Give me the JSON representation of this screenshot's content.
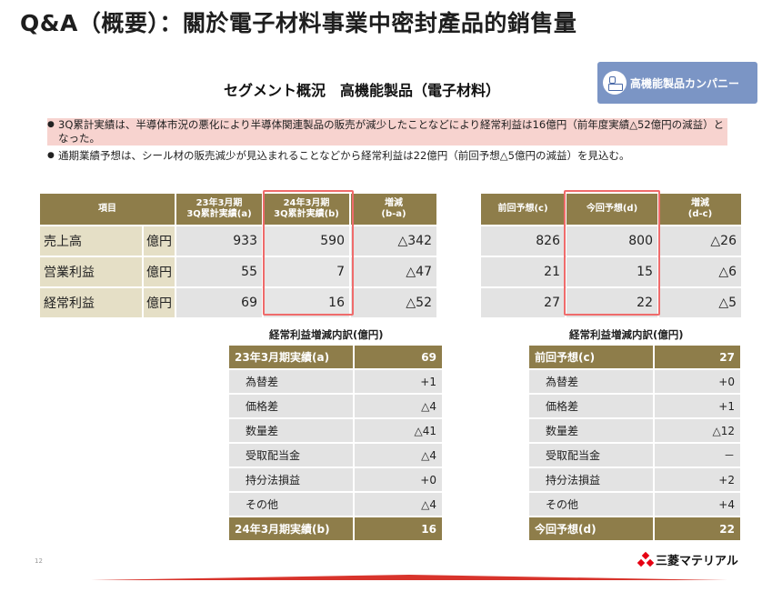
{
  "page": {
    "title": "Q&A（概要）：關於電子材料事業中密封產品的銷售量",
    "slide_heading": "セグメント概況　高機能製品（電子材料）",
    "badge_label": "高機能製品カンパニー",
    "page_number": "12",
    "company_logo_text": "三菱マテリアル"
  },
  "bullets": [
    "3Q累計実績は、半導体市況の悪化により半導体関連製品の販売が減少したことなどにより経常利益は16億円（前年度実績△52億円の減益）となった。",
    "通期業績予想は、シール材の販売減少が見込まれることなどから経常利益は22億円（前回予想△5億円の減益）を見込む。"
  ],
  "summary_left": {
    "headers": [
      "項目",
      "23年3月期\n3Q累計実績(a)",
      "24年3月期\n3Q累計実績(b)",
      "増減\n(b-a)"
    ],
    "rows": [
      {
        "item": "売上高",
        "unit": "億円",
        "a": "933",
        "b": "590",
        "diff": "△342"
      },
      {
        "item": "営業利益",
        "unit": "億円",
        "a": "55",
        "b": "7",
        "diff": "△47"
      },
      {
        "item": "経常利益",
        "unit": "億円",
        "a": "69",
        "b": "16",
        "diff": "△52"
      }
    ]
  },
  "summary_right": {
    "headers": [
      "前回予想(c)",
      "今回予想(d)",
      "増減\n(d-c)"
    ],
    "rows": [
      {
        "c": "826",
        "d": "800",
        "diff": "△26"
      },
      {
        "c": "21",
        "d": "15",
        "diff": "△6"
      },
      {
        "c": "27",
        "d": "22",
        "diff": "△5"
      }
    ]
  },
  "breakdown_left": {
    "caption": "経常利益増減内訳(億円)",
    "start_label": "23年3月期実績(a)",
    "start_value": "69",
    "items": [
      {
        "label": "為替差",
        "value": "+1"
      },
      {
        "label": "価格差",
        "value": "△4"
      },
      {
        "label": "数量差",
        "value": "△41"
      },
      {
        "label": "受取配当金",
        "value": "△4"
      },
      {
        "label": "持分法損益",
        "value": "+0"
      },
      {
        "label": "その他",
        "value": "△4"
      }
    ],
    "end_label": "24年3月期実績(b)",
    "end_value": "16"
  },
  "breakdown_right": {
    "caption": "経常利益増減内訳(億円)",
    "start_label": "前回予想(c)",
    "start_value": "27",
    "items": [
      {
        "label": "為替差",
        "value": "+0"
      },
      {
        "label": "価格差",
        "value": "+1"
      },
      {
        "label": "数量差",
        "value": "△12"
      },
      {
        "label": "受取配当金",
        "value": "－"
      },
      {
        "label": "持分法損益",
        "value": "+2"
      },
      {
        "label": "その他",
        "value": "+4"
      }
    ],
    "end_label": "今回予想(d)",
    "end_value": "22"
  },
  "colors": {
    "header_olive": "#8e7d4a",
    "label_beige": "#e5dfc6",
    "cell_gray": "#e3e3e3",
    "highlight_red": "#ef6b6b",
    "badge_blue": "#7b95c5",
    "logo_red": "#e60012"
  }
}
